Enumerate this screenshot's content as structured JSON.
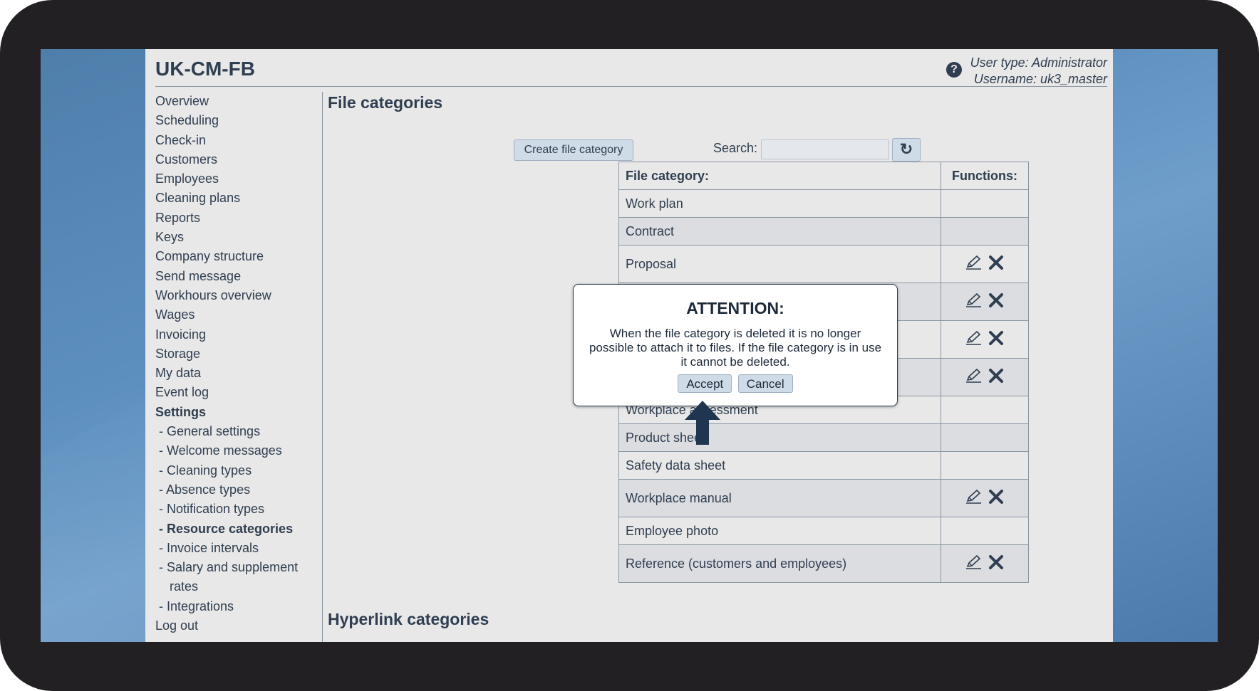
{
  "app": {
    "title": "UK-CM-FB",
    "user_type": "User type: Administrator",
    "username": "Username: uk3_master",
    "help_icon": "question-circle-icon"
  },
  "sidebar": {
    "items": [
      "Overview",
      "Scheduling",
      "Check-in",
      "Customers",
      "Employees",
      "Cleaning plans",
      "Reports",
      "Keys",
      "Company structure",
      "Send message",
      "Workhours overview",
      "Wages",
      "Invoicing",
      "Storage",
      "My data",
      "Event log"
    ],
    "settings_label": "Settings",
    "settings_items": [
      "- General settings",
      "- Welcome messages",
      "- Cleaning types",
      "- Absence types",
      "- Notification types"
    ],
    "active_item": "- Resource categories",
    "settings_items_after": [
      "- Invoice intervals"
    ],
    "salary_item": "- Salary and supplement rates",
    "integrations_item": "- Integrations",
    "logout": "Log out"
  },
  "main": {
    "title": "File categories",
    "create_button": "Create file category",
    "search_label": "Search:",
    "search_value": "",
    "refresh_icon": "refresh-icon",
    "table": {
      "headers": [
        "File category:",
        "Functions:"
      ],
      "rows": [
        {
          "name": "Work plan",
          "editable": false
        },
        {
          "name": "Contract",
          "editable": false
        },
        {
          "name": "Proposal",
          "editable": true
        },
        {
          "name": "",
          "editable": true
        },
        {
          "name": "",
          "editable": true
        },
        {
          "name": "",
          "editable": true
        },
        {
          "name": "Workplace assessment",
          "editable": false
        },
        {
          "name": "Product sheet",
          "editable": false
        },
        {
          "name": "Safety data sheet",
          "editable": false
        },
        {
          "name": "Workplace manual",
          "editable": true
        },
        {
          "name": "Employee photo",
          "editable": false
        },
        {
          "name": "Reference (customers and employees)",
          "editable": true
        }
      ]
    },
    "second_title": "Hyperlink categories"
  },
  "dialog": {
    "title": "ATTENTION:",
    "message": "When the file category is deleted it is no longer possible to attach it to files. If the file category is in use it cannot be deleted.",
    "accept": "Accept",
    "cancel": "Cancel"
  },
  "colors": {
    "frame": "#222023",
    "desktop": "#5d8fbe",
    "app_bg": "#e8e8e8",
    "text": "#2f3e50",
    "button": "#cfdbe6",
    "arrow": "#1f3550"
  }
}
